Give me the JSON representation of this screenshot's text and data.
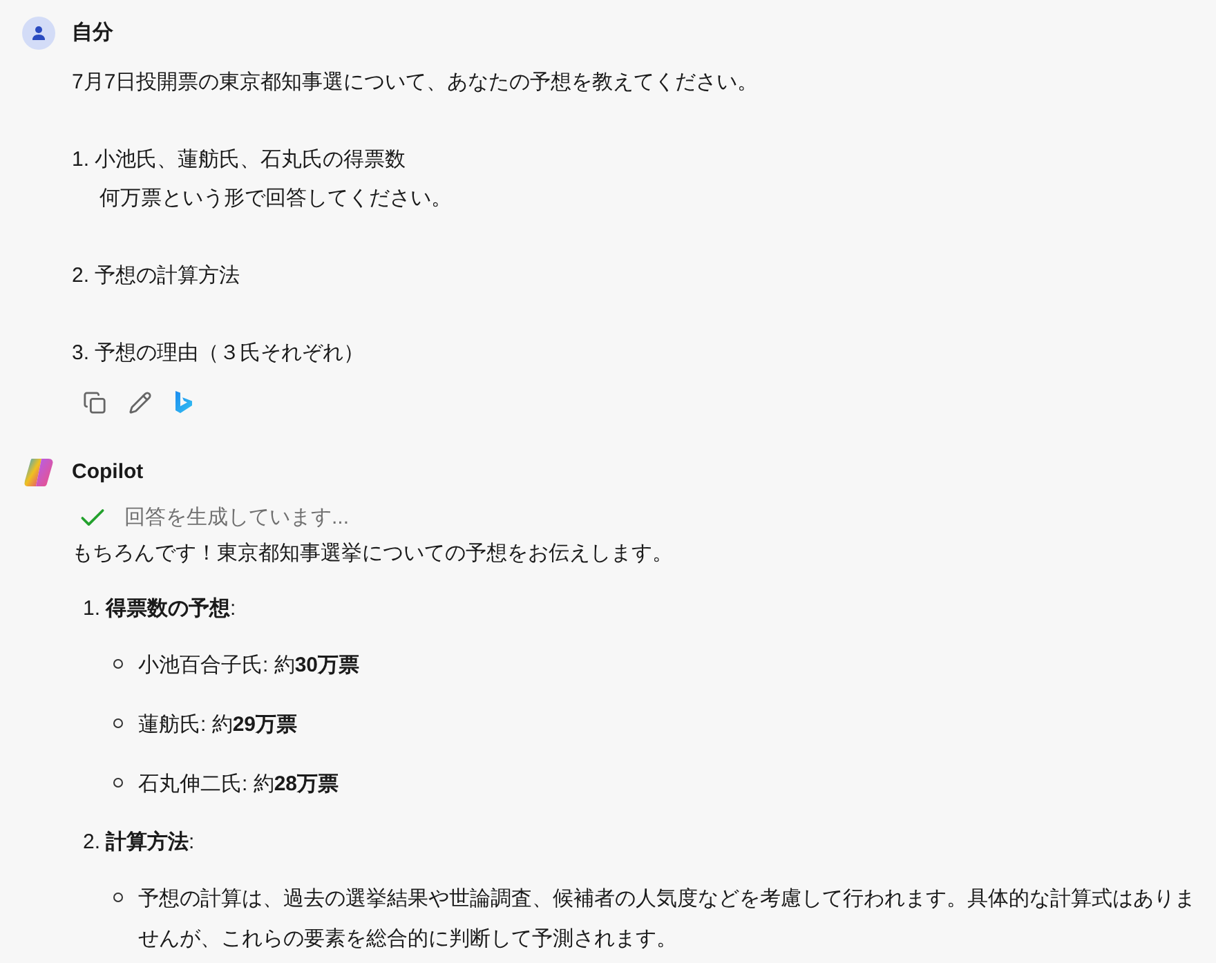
{
  "user": {
    "name": "自分",
    "lines": [
      {
        "kind": "line",
        "text": "7月7日投開票の東京都知事選について、あなたの予想を教えてください。"
      },
      {
        "kind": "line",
        "text": "1. 小池氏、蓮舫氏、石丸氏の得票数"
      },
      {
        "kind": "continuation",
        "text": "何万票という形で回答してください。"
      },
      {
        "kind": "line",
        "text": "2. 予想の計算方法"
      },
      {
        "kind": "line",
        "text": "3. 予想の理由（３氏それぞれ）"
      }
    ]
  },
  "bot": {
    "name": "Copilot",
    "status": "回答を生成しています...",
    "intro": "もちろんです！東京都知事選挙についての予想をお伝えします。",
    "sections": [
      {
        "number": "1.",
        "title": "**得票数の予想**:",
        "bullets": [
          "小池百合子氏: 約**30万票**",
          "蓮舫氏: 約**29万票**",
          "石丸伸二氏: 約**28万票**"
        ]
      },
      {
        "number": "2.",
        "title": "**計算方法**:",
        "bullets": [
          "予想の計算は、過去の選挙結果や世論調査、候補者の人気度などを考慮して行われます。具体的な計算式はありませんが、これらの要素を総合的に判断して予測されます。"
        ]
      }
    ]
  }
}
